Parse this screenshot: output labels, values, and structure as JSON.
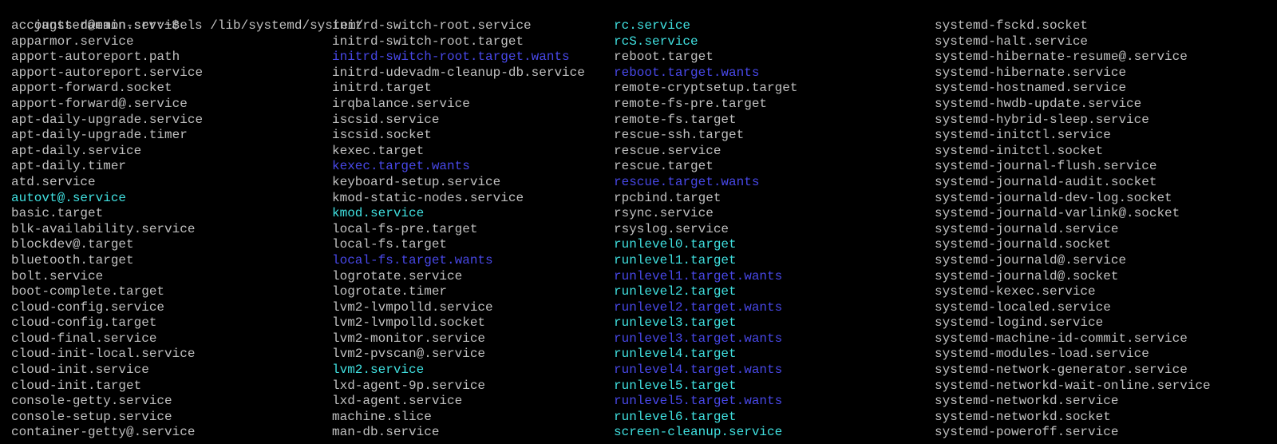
{
  "terminal": {
    "previous_line_partial": "",
    "prompt": "jagster@main-srv:~$ ",
    "command": "ls /lib/systemd/system/",
    "colors": {
      "background": "#000000",
      "plain": "#c0c0c0",
      "symlink": "#40e0e0",
      "directory": "#4848e8"
    },
    "columns": [
      [
        {
          "name": "accounts-daemon.service",
          "type": "plain"
        },
        {
          "name": "apparmor.service",
          "type": "plain"
        },
        {
          "name": "apport-autoreport.path",
          "type": "plain"
        },
        {
          "name": "apport-autoreport.service",
          "type": "plain"
        },
        {
          "name": "apport-forward.socket",
          "type": "plain"
        },
        {
          "name": "apport-forward@.service",
          "type": "plain"
        },
        {
          "name": "apt-daily-upgrade.service",
          "type": "plain"
        },
        {
          "name": "apt-daily-upgrade.timer",
          "type": "plain"
        },
        {
          "name": "apt-daily.service",
          "type": "plain"
        },
        {
          "name": "apt-daily.timer",
          "type": "plain"
        },
        {
          "name": "atd.service",
          "type": "plain"
        },
        {
          "name": "autovt@.service",
          "type": "link"
        },
        {
          "name": "basic.target",
          "type": "plain"
        },
        {
          "name": "blk-availability.service",
          "type": "plain"
        },
        {
          "name": "blockdev@.target",
          "type": "plain"
        },
        {
          "name": "bluetooth.target",
          "type": "plain"
        },
        {
          "name": "bolt.service",
          "type": "plain"
        },
        {
          "name": "boot-complete.target",
          "type": "plain"
        },
        {
          "name": "cloud-config.service",
          "type": "plain"
        },
        {
          "name": "cloud-config.target",
          "type": "plain"
        },
        {
          "name": "cloud-final.service",
          "type": "plain"
        },
        {
          "name": "cloud-init-local.service",
          "type": "plain"
        },
        {
          "name": "cloud-init.service",
          "type": "plain"
        },
        {
          "name": "cloud-init.target",
          "type": "plain"
        },
        {
          "name": "console-getty.service",
          "type": "plain"
        },
        {
          "name": "console-setup.service",
          "type": "plain"
        },
        {
          "name": "container-getty@.service",
          "type": "plain"
        }
      ],
      [
        {
          "name": "initrd-switch-root.service",
          "type": "plain"
        },
        {
          "name": "initrd-switch-root.target",
          "type": "plain"
        },
        {
          "name": "initrd-switch-root.target.wants",
          "type": "dir"
        },
        {
          "name": "initrd-udevadm-cleanup-db.service",
          "type": "plain"
        },
        {
          "name": "initrd.target",
          "type": "plain"
        },
        {
          "name": "irqbalance.service",
          "type": "plain"
        },
        {
          "name": "iscsid.service",
          "type": "plain"
        },
        {
          "name": "iscsid.socket",
          "type": "plain"
        },
        {
          "name": "kexec.target",
          "type": "plain"
        },
        {
          "name": "kexec.target.wants",
          "type": "dir"
        },
        {
          "name": "keyboard-setup.service",
          "type": "plain"
        },
        {
          "name": "kmod-static-nodes.service",
          "type": "plain"
        },
        {
          "name": "kmod.service",
          "type": "link"
        },
        {
          "name": "local-fs-pre.target",
          "type": "plain"
        },
        {
          "name": "local-fs.target",
          "type": "plain"
        },
        {
          "name": "local-fs.target.wants",
          "type": "dir"
        },
        {
          "name": "logrotate.service",
          "type": "plain"
        },
        {
          "name": "logrotate.timer",
          "type": "plain"
        },
        {
          "name": "lvm2-lvmpolld.service",
          "type": "plain"
        },
        {
          "name": "lvm2-lvmpolld.socket",
          "type": "plain"
        },
        {
          "name": "lvm2-monitor.service",
          "type": "plain"
        },
        {
          "name": "lvm2-pvscan@.service",
          "type": "plain"
        },
        {
          "name": "lvm2.service",
          "type": "link"
        },
        {
          "name": "lxd-agent-9p.service",
          "type": "plain"
        },
        {
          "name": "lxd-agent.service",
          "type": "plain"
        },
        {
          "name": "machine.slice",
          "type": "plain"
        },
        {
          "name": "man-db.service",
          "type": "plain"
        }
      ],
      [
        {
          "name": "rc.service",
          "type": "link"
        },
        {
          "name": "rcS.service",
          "type": "link"
        },
        {
          "name": "reboot.target",
          "type": "plain"
        },
        {
          "name": "reboot.target.wants",
          "type": "dir"
        },
        {
          "name": "remote-cryptsetup.target",
          "type": "plain"
        },
        {
          "name": "remote-fs-pre.target",
          "type": "plain"
        },
        {
          "name": "remote-fs.target",
          "type": "plain"
        },
        {
          "name": "rescue-ssh.target",
          "type": "plain"
        },
        {
          "name": "rescue.service",
          "type": "plain"
        },
        {
          "name": "rescue.target",
          "type": "plain"
        },
        {
          "name": "rescue.target.wants",
          "type": "dir"
        },
        {
          "name": "rpcbind.target",
          "type": "plain"
        },
        {
          "name": "rsync.service",
          "type": "plain"
        },
        {
          "name": "rsyslog.service",
          "type": "plain"
        },
        {
          "name": "runlevel0.target",
          "type": "link"
        },
        {
          "name": "runlevel1.target",
          "type": "link"
        },
        {
          "name": "runlevel1.target.wants",
          "type": "dir"
        },
        {
          "name": "runlevel2.target",
          "type": "link"
        },
        {
          "name": "runlevel2.target.wants",
          "type": "dir"
        },
        {
          "name": "runlevel3.target",
          "type": "link"
        },
        {
          "name": "runlevel3.target.wants",
          "type": "dir"
        },
        {
          "name": "runlevel4.target",
          "type": "link"
        },
        {
          "name": "runlevel4.target.wants",
          "type": "dir"
        },
        {
          "name": "runlevel5.target",
          "type": "link"
        },
        {
          "name": "runlevel5.target.wants",
          "type": "dir"
        },
        {
          "name": "runlevel6.target",
          "type": "link"
        },
        {
          "name": "screen-cleanup.service",
          "type": "link"
        }
      ],
      [
        {
          "name": "systemd-fsckd.socket",
          "type": "plain"
        },
        {
          "name": "systemd-halt.service",
          "type": "plain"
        },
        {
          "name": "systemd-hibernate-resume@.service",
          "type": "plain"
        },
        {
          "name": "systemd-hibernate.service",
          "type": "plain"
        },
        {
          "name": "systemd-hostnamed.service",
          "type": "plain"
        },
        {
          "name": "systemd-hwdb-update.service",
          "type": "plain"
        },
        {
          "name": "systemd-hybrid-sleep.service",
          "type": "plain"
        },
        {
          "name": "systemd-initctl.service",
          "type": "plain"
        },
        {
          "name": "systemd-initctl.socket",
          "type": "plain"
        },
        {
          "name": "systemd-journal-flush.service",
          "type": "plain"
        },
        {
          "name": "systemd-journald-audit.socket",
          "type": "plain"
        },
        {
          "name": "systemd-journald-dev-log.socket",
          "type": "plain"
        },
        {
          "name": "systemd-journald-varlink@.socket",
          "type": "plain"
        },
        {
          "name": "systemd-journald.service",
          "type": "plain"
        },
        {
          "name": "systemd-journald.socket",
          "type": "plain"
        },
        {
          "name": "systemd-journald@.service",
          "type": "plain"
        },
        {
          "name": "systemd-journald@.socket",
          "type": "plain"
        },
        {
          "name": "systemd-kexec.service",
          "type": "plain"
        },
        {
          "name": "systemd-localed.service",
          "type": "plain"
        },
        {
          "name": "systemd-logind.service",
          "type": "plain"
        },
        {
          "name": "systemd-machine-id-commit.service",
          "type": "plain"
        },
        {
          "name": "systemd-modules-load.service",
          "type": "plain"
        },
        {
          "name": "systemd-network-generator.service",
          "type": "plain"
        },
        {
          "name": "systemd-networkd-wait-online.service",
          "type": "plain"
        },
        {
          "name": "systemd-networkd.service",
          "type": "plain"
        },
        {
          "name": "systemd-networkd.socket",
          "type": "plain"
        },
        {
          "name": "systemd-poweroff.service",
          "type": "plain"
        }
      ]
    ]
  }
}
